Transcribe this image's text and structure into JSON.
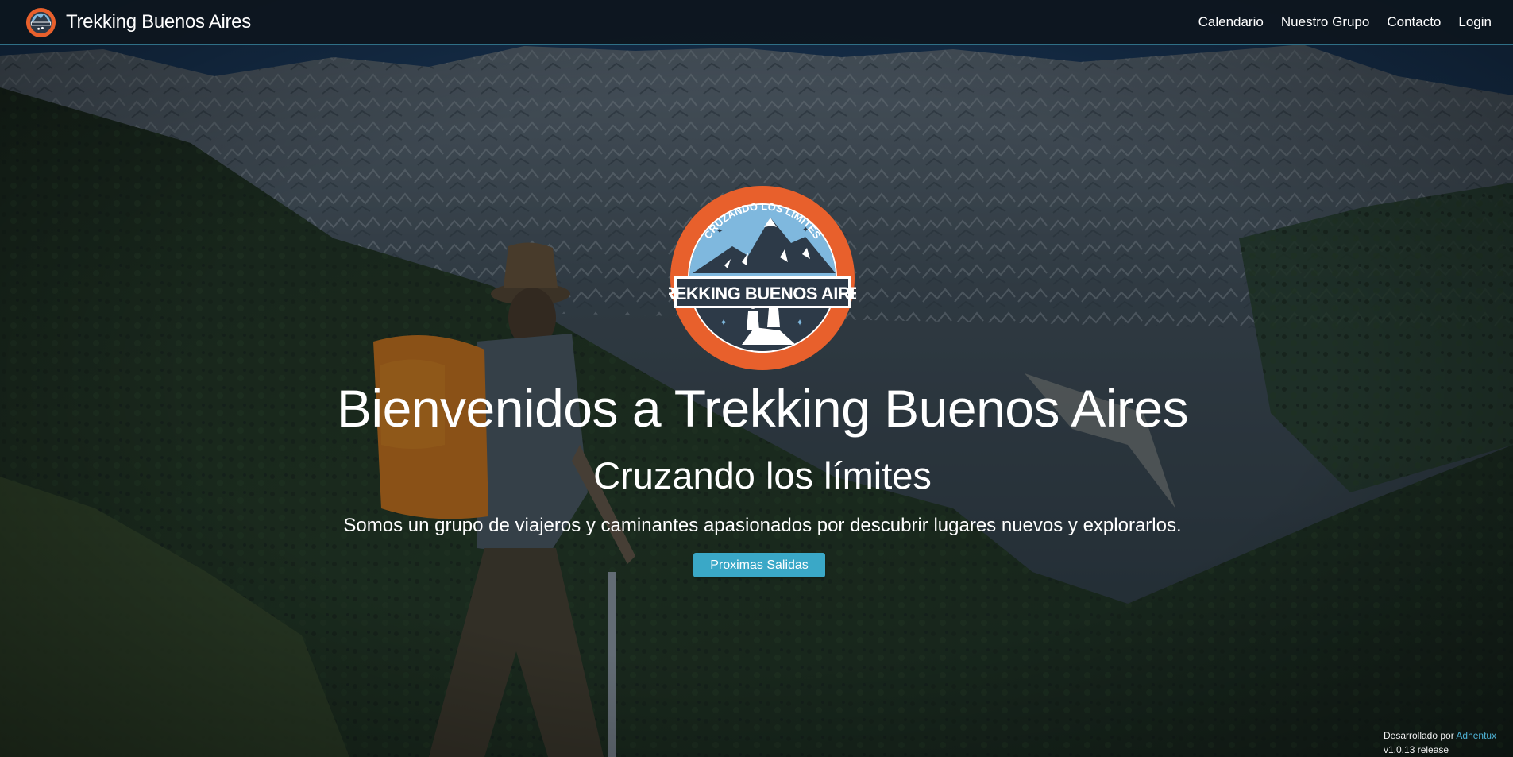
{
  "navbar": {
    "brand_title": "Trekking Buenos Aires",
    "links": [
      "Calendario",
      "Nuestro Grupo",
      "Contacto",
      "Login"
    ]
  },
  "hero": {
    "logo_top_text": "CRUZANDO LOS LIMITES",
    "logo_banner_text": "TREKKING BUENOS AIRES",
    "title": "Bienvenidos a Trekking Buenos Aires",
    "subtitle": "Cruzando los límites",
    "description": "Somos un grupo de viajeros y caminantes apasionados por descubrir lugares nuevos y explorarlos.",
    "cta_label": "Proximas Salidas"
  },
  "footer": {
    "developed_by": "Desarrollado por",
    "developer_link": "Adhentux",
    "version": "v1.0.13 release"
  },
  "colors": {
    "navbar_bg": "#0d161e",
    "accent": "#3aa8c7",
    "logo_orange": "#e8602c",
    "logo_sky": "#7fb8de",
    "logo_dark": "#2d3a48"
  }
}
